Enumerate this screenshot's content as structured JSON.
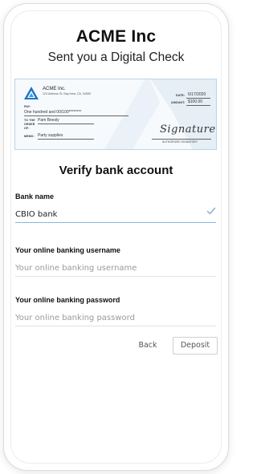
{
  "header": {
    "company": "ACME Inc",
    "subtitle": "Sent you a Digital Check"
  },
  "check": {
    "company": "ACME Inc.",
    "address": "123 Address St. Bay Area, CA, 94080",
    "date_label": "DATE:",
    "date": "6/17/2020",
    "amount_label": "AMOUNT:",
    "amount": "$100.00",
    "pay_label": "PAY:",
    "amount_words": "One hundred and 00/100********",
    "order_label_1": "TO THE",
    "order_label_2": "ORDER",
    "order_label_3": "OF:",
    "payee": "Pam Beesly",
    "memo_label": "MEMO:",
    "memo": "Party supplies",
    "signature": "Signature",
    "authorized_label": "AUTHORIZED SIGNATORY",
    "logo_color": "#1f73c4"
  },
  "verify": {
    "title": "Verify bank account"
  },
  "form": {
    "bank_name_label": "Bank name",
    "bank_name_value": "CBIO bank",
    "username_label": "Your online banking username",
    "username_placeholder": "Your online banking username",
    "password_label": "Your online banking password",
    "password_placeholder": "Your online banking password",
    "check_icon_color": "#7fb0d9"
  },
  "actions": {
    "back_label": "Back",
    "deposit_label": "Deposit"
  }
}
